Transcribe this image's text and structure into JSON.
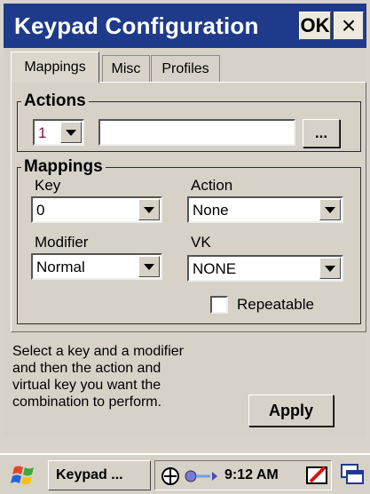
{
  "window": {
    "title": "Keypad Configuration",
    "ok_label": "OK",
    "close_label": "×"
  },
  "tabs": [
    {
      "label": "Mappings",
      "active": true
    },
    {
      "label": "Misc",
      "active": false
    },
    {
      "label": "Profiles",
      "active": false
    }
  ],
  "actions_group": {
    "legend": "Actions",
    "number_value": "1",
    "text_value": "",
    "browse_label": "..."
  },
  "mappings_group": {
    "legend": "Mappings",
    "key_label": "Key",
    "key_value": "0",
    "action_label": "Action",
    "action_value": "None",
    "modifier_label": "Modifier",
    "modifier_value": "Normal",
    "vk_label": "VK",
    "vk_value": "NONE",
    "repeatable_label": "Repeatable",
    "repeatable_checked": false
  },
  "help_text": "Select a key and a modifier\nand then the action and\nvirtual key you want the\ncombination to perform.",
  "apply_label": "Apply",
  "taskbar": {
    "task_label": "Keypad ...",
    "clock": "9:12 AM"
  },
  "colors": {
    "titlebar": "#1f3a8a",
    "face": "#d7d2c8"
  },
  "icons": [
    "windows-start-icon",
    "network-icon",
    "connection-icon",
    "pen-icon",
    "desktop-switch-icon",
    "dropdown-arrow-icon",
    "checkbox-icon"
  ]
}
